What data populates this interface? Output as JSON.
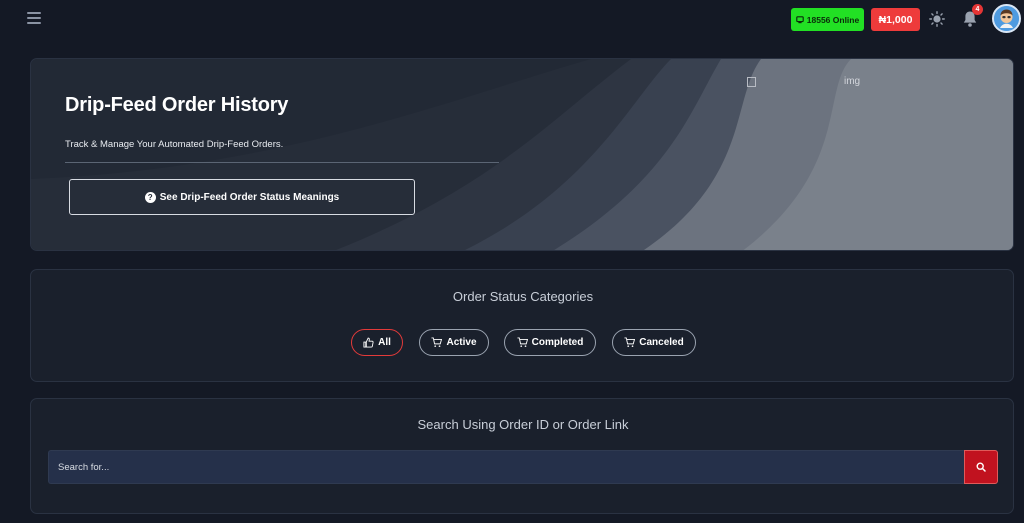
{
  "topbar": {
    "online_text": "18556 Online",
    "balance_text": "₦1,000",
    "notification_count": "4"
  },
  "hero": {
    "title": "Drip-Feed Order History",
    "subtitle": "Track & Manage Your Automated Drip-Feed Orders.",
    "status_button_label": "See Drip-Feed Order Status Meanings",
    "image_alt": "img"
  },
  "categories": {
    "title": "Order Status Categories",
    "items": [
      {
        "label": "All",
        "icon": "thumbs-up-icon"
      },
      {
        "label": "Active",
        "icon": "cart-icon"
      },
      {
        "label": "Completed",
        "icon": "cart-icon"
      },
      {
        "label": "Canceled",
        "icon": "cart-icon"
      }
    ]
  },
  "search": {
    "title": "Search Using Order ID or Order Link",
    "placeholder": "Search for..."
  },
  "colors": {
    "background": "#141925",
    "online_green": "#22e024",
    "balance_red": "#ee3b3b",
    "search_button_red": "#c1121f"
  }
}
